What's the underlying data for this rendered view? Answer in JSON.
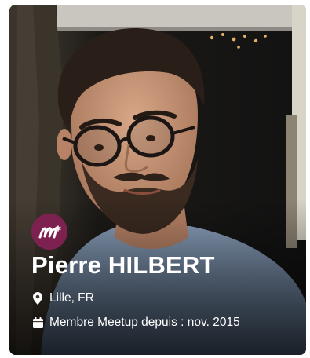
{
  "profile": {
    "name": "Pierre HILBERT",
    "location": "Lille, FR",
    "member_since": "Membre Meetup depuis : nov. 2015",
    "badge_letters": "m*"
  },
  "icons": {
    "badge": "meetup-logo-icon",
    "location": "location-pin-icon",
    "member": "calendar-icon"
  },
  "colors": {
    "badge_bg": "#7d2250",
    "text": "#ffffff",
    "shirt": "#7b93b0"
  }
}
